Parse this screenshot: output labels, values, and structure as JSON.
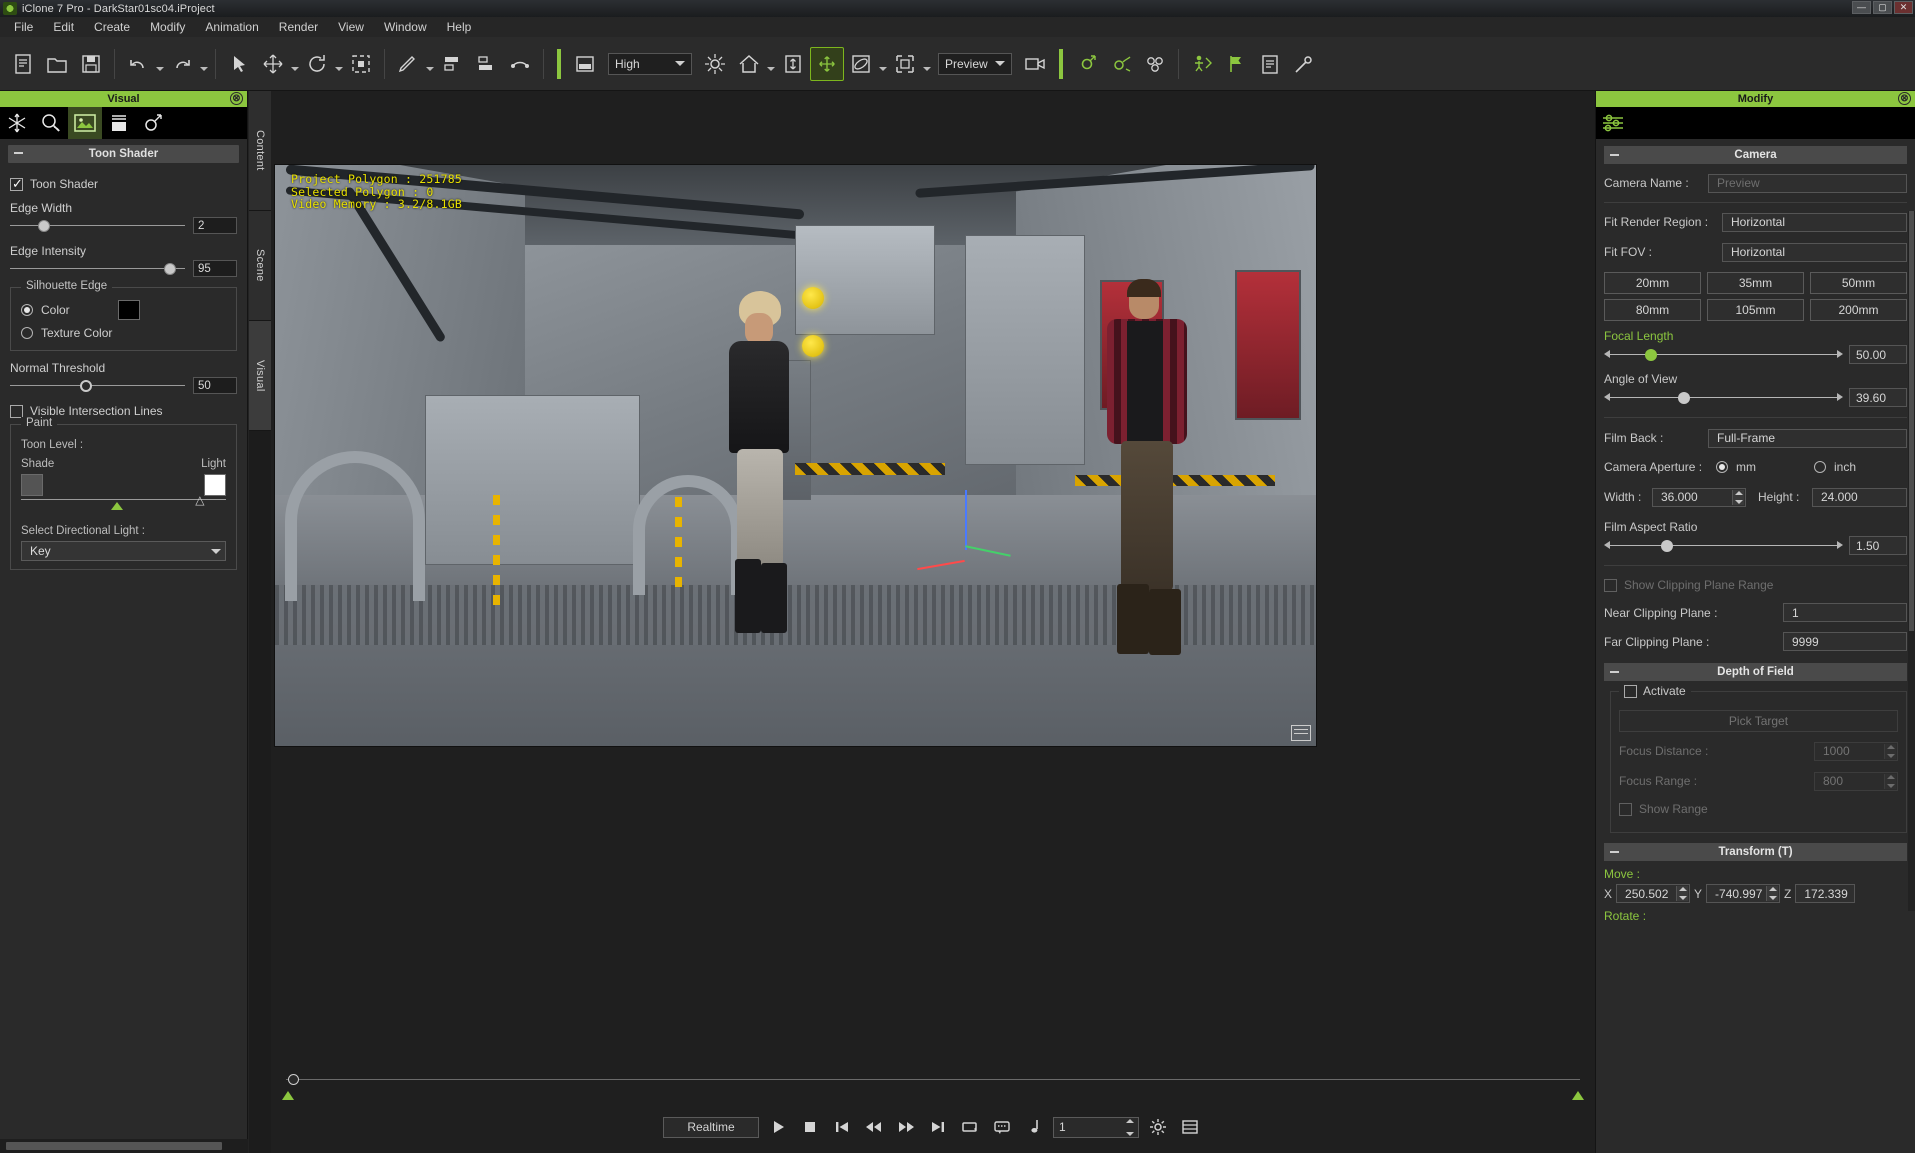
{
  "window": {
    "title": "iClone 7 Pro - DarkStar01sc04.iProject",
    "app_icon": "iclone-logo-icon",
    "buttons": {
      "minimize": "—",
      "maximize": "▢",
      "close": "✕"
    }
  },
  "menu": {
    "items": [
      "File",
      "Edit",
      "Create",
      "Modify",
      "Animation",
      "Render",
      "View",
      "Window",
      "Help"
    ]
  },
  "toolbar": {
    "items": [
      {
        "name": "new-project-icon",
        "glyph": "page"
      },
      {
        "name": "open-project-icon",
        "glyph": "folder"
      },
      {
        "name": "save-project-icon",
        "glyph": "floppy"
      },
      {
        "name": "undo-icon",
        "glyph": "undo"
      },
      {
        "name": "redo-icon",
        "glyph": "redo"
      },
      {
        "name": "select-tool-icon",
        "glyph": "cursor"
      },
      {
        "name": "move-tool-icon",
        "glyph": "move"
      },
      {
        "name": "rotate-tool-icon",
        "glyph": "rotate"
      },
      {
        "name": "scale-tool-icon",
        "glyph": "scale"
      },
      {
        "name": "edit-motion-icon",
        "glyph": "brush"
      },
      {
        "name": "align-icon",
        "glyph": "align"
      },
      {
        "name": "distribute-icon",
        "glyph": "distribute"
      },
      {
        "name": "link-icon",
        "glyph": "link"
      },
      {
        "name": "viewport-layout-icon",
        "glyph": "layout"
      },
      {
        "name": "light-toggle-icon",
        "glyph": "sun"
      },
      {
        "name": "home-view-icon",
        "glyph": "home"
      },
      {
        "name": "fit-to-view-icon",
        "glyph": "fit"
      },
      {
        "name": "pan-view-icon",
        "glyph": "pan"
      },
      {
        "name": "orbit-view-icon",
        "glyph": "orbit"
      },
      {
        "name": "zoom-view-icon",
        "glyph": "zoomframe"
      },
      {
        "name": "record-camera-icon",
        "glyph": "camcorder"
      },
      {
        "name": "motion-path-icon",
        "glyph": "path"
      },
      {
        "name": "motion-curve-icon",
        "glyph": "curve"
      },
      {
        "name": "physics-icon",
        "glyph": "physics"
      },
      {
        "name": "reach-target-icon",
        "glyph": "reach"
      },
      {
        "name": "flag-icon",
        "glyph": "flag"
      },
      {
        "name": "content-manager-icon",
        "glyph": "clipboard"
      },
      {
        "name": "preference-icon",
        "glyph": "wrench"
      }
    ],
    "render_quality": "High",
    "preview_mode": "Preview"
  },
  "left_panel": {
    "title": "Visual",
    "close_icon": "close-icon",
    "tabs": [
      {
        "name": "tab-atmosphere",
        "icon": "snowflake-icon",
        "selected": false
      },
      {
        "name": "tab-light",
        "icon": "bulb-icon",
        "selected": false
      },
      {
        "name": "tab-visual-effects",
        "icon": "image-icon",
        "selected": true
      },
      {
        "name": "tab-background",
        "icon": "backdrop-icon",
        "selected": false
      },
      {
        "name": "tab-particle",
        "icon": "particle-icon",
        "selected": false
      }
    ],
    "section_title": "Toon Shader",
    "toon_shader": {
      "label": "Toon Shader",
      "checked": true
    },
    "edge_width": {
      "label": "Edge Width",
      "value": "2",
      "slider_pct": 18
    },
    "edge_intensity": {
      "label": "Edge Intensity",
      "value": "95",
      "slider_pct": 91
    },
    "silhouette_edge": {
      "title": "Silhouette Edge",
      "color_option": {
        "label": "Color",
        "selected": true,
        "swatch": "#000000"
      },
      "texture_option": {
        "label": "Texture Color",
        "selected": false
      }
    },
    "normal_threshold": {
      "label": "Normal Threshold",
      "value": "50",
      "slider_pct": 40
    },
    "visible_intersection_lines": {
      "label": "Visible Intersection Lines",
      "checked": false
    },
    "paint": {
      "title": "Paint",
      "toon_level_label": "Toon Level :",
      "shade_label": "Shade",
      "light_label": "Light",
      "shade_color": "#545454",
      "light_color": "#ffffff",
      "marker_green_pct": 47,
      "marker_hollow_pct": 87
    },
    "select_directional_light": {
      "label": "Select Directional Light :",
      "value": "Key"
    }
  },
  "vertical_tabs": [
    {
      "label": "Content",
      "selected": false
    },
    {
      "label": "Scene",
      "selected": false
    },
    {
      "label": "Visual",
      "selected": true
    }
  ],
  "viewport": {
    "stats": {
      "project_polygon": "Project Polygon : 251785",
      "selected_polygon": "Selected Polygon : 0",
      "video_memory": "Video Memory : 3.2/8.1GB"
    },
    "corner_icon": "viewport-options-icon"
  },
  "timeline": {
    "playhead_position": 0
  },
  "playback": {
    "mode": "Realtime",
    "buttons": [
      {
        "name": "play-button",
        "glyph": "▶"
      },
      {
        "name": "stop-button",
        "glyph": "■"
      },
      {
        "name": "go-to-start-button",
        "glyph": "|◀"
      },
      {
        "name": "prev-frame-button",
        "glyph": "◀◀"
      },
      {
        "name": "next-frame-button",
        "glyph": "▶▶"
      },
      {
        "name": "go-to-end-button",
        "glyph": "▶|"
      },
      {
        "name": "loop-button",
        "glyph": "loop"
      },
      {
        "name": "subtitle-button",
        "glyph": "caption"
      },
      {
        "name": "audio-button",
        "glyph": "note"
      }
    ],
    "frame_value": "1",
    "settings_icon": "gear-icon",
    "timeline-icon": "timeline-icon"
  },
  "right_panel": {
    "title": "Modify",
    "close_icon": "close-icon",
    "tab_icon": "sliders-icon",
    "camera": {
      "section_title": "Camera",
      "camera_name": {
        "label": "Camera Name :",
        "placeholder": "Preview",
        "value": ""
      },
      "fit_render_region": {
        "label": "Fit Render Region :",
        "value": "Horizontal"
      },
      "fit_fov": {
        "label": "Fit FOV :",
        "value": "Horizontal"
      },
      "focal_presets": [
        "20mm",
        "35mm",
        "50mm",
        "80mm",
        "105mm",
        "200mm"
      ],
      "focal_length": {
        "label": "Focal Length",
        "value": "50.00",
        "slider_pct": 19
      },
      "angle_of_view": {
        "label": "Angle of View",
        "value": "39.60",
        "slider_pct": 33
      },
      "film_back": {
        "label": "Film Back :",
        "value": "Full-Frame"
      },
      "camera_aperture": {
        "label": "Camera Aperture :",
        "mm": {
          "label": "mm",
          "selected": true
        },
        "inch": {
          "label": "inch",
          "selected": false
        }
      },
      "width": {
        "label": "Width :",
        "value": "36.000"
      },
      "height": {
        "label": "Height :",
        "value": "24.000"
      },
      "film_aspect_ratio": {
        "label": "Film Aspect Ratio",
        "value": "1.50",
        "slider_pct": 26
      },
      "show_clipping_plane_range": {
        "label": "Show Clipping Plane Range",
        "checked": false,
        "disabled": true
      },
      "near_clipping_plane": {
        "label": "Near Clipping Plane :",
        "value": "1"
      },
      "far_clipping_plane": {
        "label": "Far Clipping Plane :",
        "value": "9999"
      }
    },
    "depth_of_field": {
      "section_title": "Depth of Field",
      "activate": {
        "label": "Activate",
        "checked": false
      },
      "pick_target": "Pick Target",
      "focus_distance": {
        "label": "Focus Distance :",
        "value": "1000"
      },
      "focus_range": {
        "label": "Focus Range :",
        "value": "800"
      },
      "show_range": {
        "label": "Show Range",
        "checked": false
      }
    },
    "transform": {
      "section_title": "Transform  (T)",
      "move_label": "Move :",
      "axis_x": "X",
      "axis_y": "Y",
      "axis_z": "Z",
      "x": "250.502",
      "y": "-740.997",
      "z": "172.339",
      "rotate_label": "Rotate :"
    }
  },
  "colors": {
    "accent": "#8cc63f",
    "panel": "#2a2a2a",
    "stats_text": "#e8e000"
  }
}
